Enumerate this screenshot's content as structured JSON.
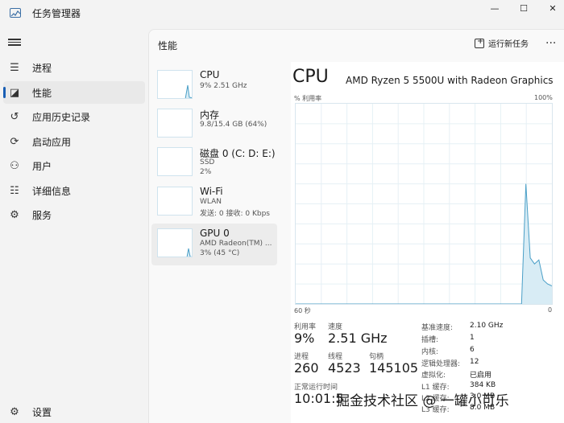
{
  "window": {
    "title": "任务管理器",
    "minimize": "—",
    "maximize": "☐",
    "close": "✕"
  },
  "nav": {
    "items": [
      {
        "label": "进程",
        "icon": "process-icon",
        "glyph": "☰"
      },
      {
        "label": "性能",
        "icon": "performance-icon",
        "glyph": "◪",
        "active": true
      },
      {
        "label": "应用历史记录",
        "icon": "history-icon",
        "glyph": "↺"
      },
      {
        "label": "启动应用",
        "icon": "startup-icon",
        "glyph": "⟳"
      },
      {
        "label": "用户",
        "icon": "users-icon",
        "glyph": "⚇"
      },
      {
        "label": "详细信息",
        "icon": "details-icon",
        "glyph": "☷"
      },
      {
        "label": "服务",
        "icon": "services-icon",
        "glyph": "⚙"
      }
    ],
    "settings": {
      "label": "设置",
      "icon": "settings-icon",
      "glyph": "⚙"
    }
  },
  "header": {
    "title": "性能",
    "run_new_task": "运行新任务",
    "more": "···"
  },
  "devices": [
    {
      "name": "CPU",
      "lines": [
        "9% 2.51 GHz"
      ],
      "active": false
    },
    {
      "name": "内存",
      "lines": [
        "9.8/15.4 GB (64%)"
      ],
      "active": false
    },
    {
      "name": "磁盘 0 (C: D: E:)",
      "lines": [
        "SSD",
        "2%"
      ],
      "active": false
    },
    {
      "name": "Wi-Fi",
      "lines": [
        "WLAN",
        "发送: 0 接收: 0 Kbps"
      ],
      "active": false
    },
    {
      "name": "GPU 0",
      "lines": [
        "AMD Radeon(TM) ...",
        "3% (45 °C)"
      ],
      "active": true
    }
  ],
  "detail": {
    "title": "CPU",
    "model": "AMD Ryzen 5 5500U with Radeon Graphics",
    "y_label": "% 利用率",
    "y_max": "100%",
    "x_left": "60 秒",
    "x_right": "0",
    "stats": {
      "utilization_label": "利用率",
      "utilization": "9%",
      "speed_label": "速度",
      "speed": "2.51 GHz",
      "processes_label": "进程",
      "processes": "260",
      "threads_label": "线程",
      "threads": "4523",
      "handles_label": "句柄",
      "handles": "145105",
      "uptime_label": "正常运行时间",
      "uptime": "10:01:5"
    },
    "specs": [
      {
        "label": "基准速度:",
        "value": "2.10 GHz"
      },
      {
        "label": "插槽:",
        "value": "1"
      },
      {
        "label": "内核:",
        "value": "6"
      },
      {
        "label": "逻辑处理器:",
        "value": "12"
      },
      {
        "label": "虚拟化:",
        "value": "已启用"
      },
      {
        "label": "L1 缓存:",
        "value": "384 KB"
      },
      {
        "label": "L2 缓存:",
        "value": "3.0 MB"
      },
      {
        "label": "L3 缓存:",
        "value": "8.0 MB"
      }
    ]
  },
  "chart_data": {
    "type": "area",
    "xlabel": "60 秒",
    "ylabel": "% 利用率",
    "x_range": [
      60,
      0
    ],
    "ylim": [
      0,
      100
    ],
    "grid": true,
    "series": [
      {
        "values": [
          0,
          0,
          0,
          0,
          0,
          0,
          0,
          0,
          0,
          0,
          0,
          0,
          0,
          0,
          0,
          0,
          0,
          0,
          0,
          0,
          0,
          0,
          0,
          0,
          0,
          0,
          0,
          0,
          0,
          0,
          0,
          0,
          0,
          0,
          0,
          0,
          0,
          0,
          0,
          0,
          0,
          0,
          0,
          0,
          0,
          0,
          0,
          0,
          0,
          0,
          0,
          0,
          0,
          60,
          23,
          20,
          22,
          12,
          10,
          9
        ]
      }
    ],
    "accent_color": "#4a9fc7",
    "fill_color": "#d8ecf5"
  },
  "watermark": "掘金技术社区 @ 一罐小可乐"
}
